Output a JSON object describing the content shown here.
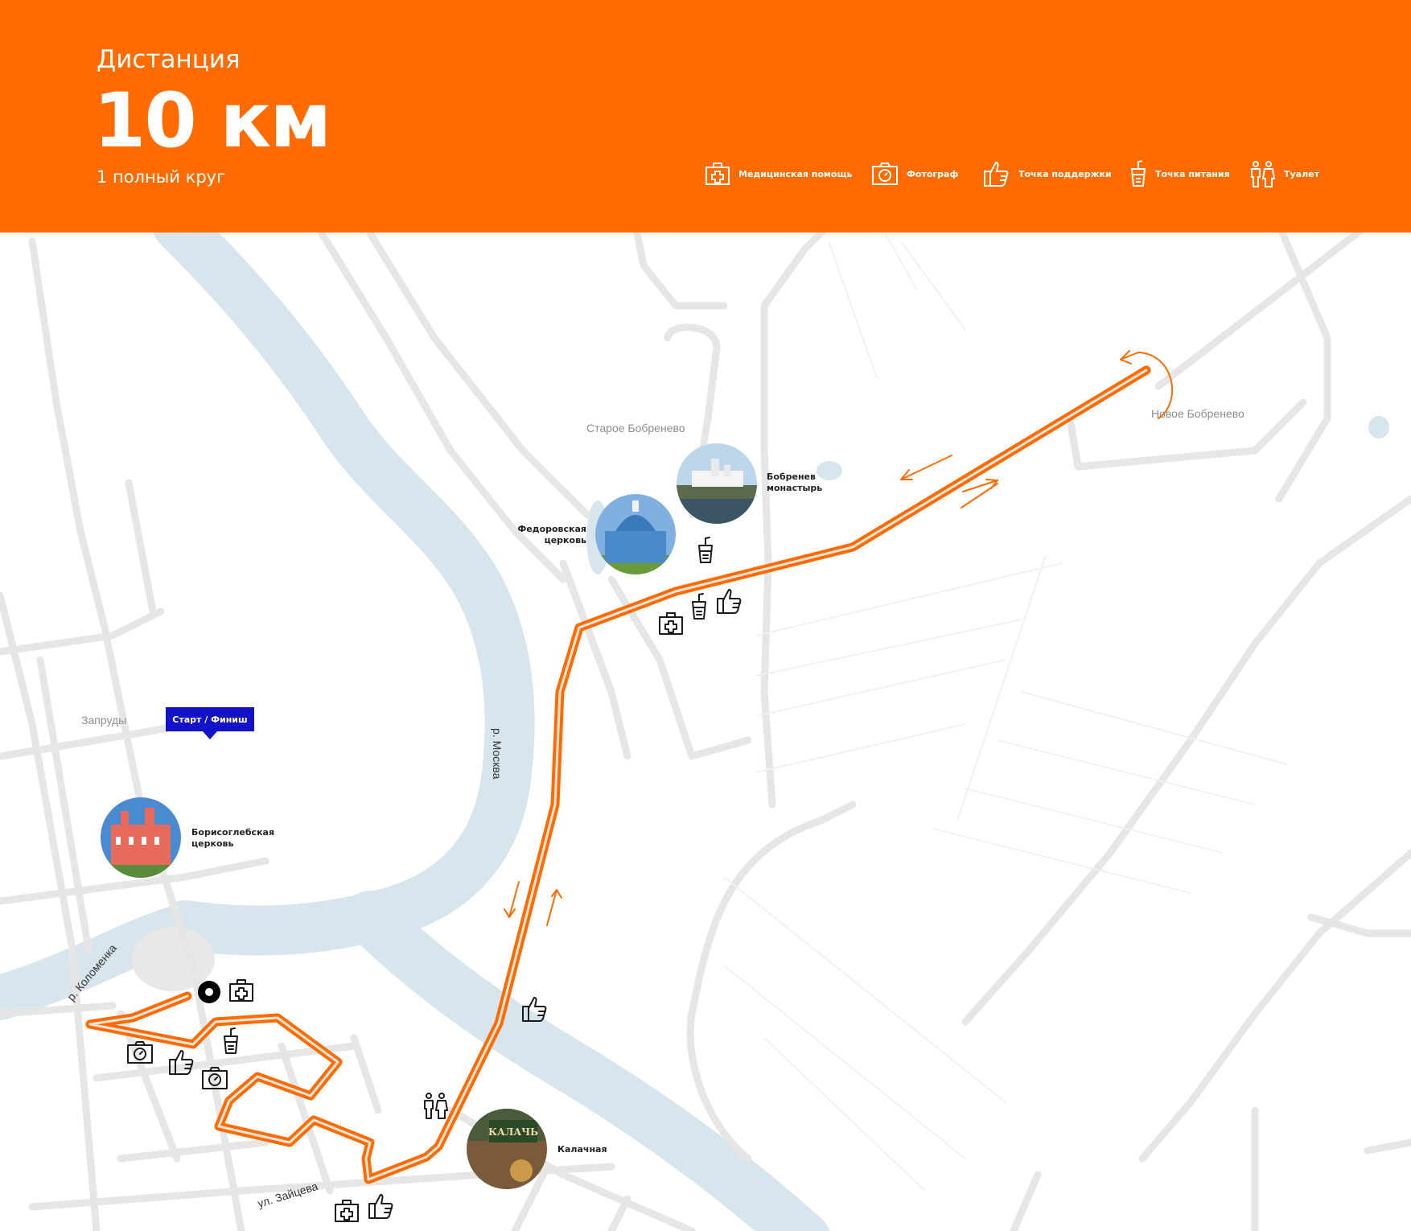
{
  "header": {
    "subtitle": "Дистанция",
    "distance": "10 км",
    "laps": "1 полный круг"
  },
  "legend": {
    "medical": "Медицинская помощь",
    "photo": "Фотограф",
    "support": "Точка поддержки",
    "food": "Точка питания",
    "toilet": "Туалет"
  },
  "places": {
    "old_bobrenevo": "Старое Бобренево",
    "new_bobrenevo": "Новое Бобренево",
    "zaprudy": "Запруды",
    "river_moskva": "р. Москва",
    "river_kolomenka": "р. Коломенка",
    "street_zaytseva": "ул. Зайцева"
  },
  "pois": {
    "monastery": "Бобренев\nмонастырь",
    "fedorovskaya": "Федоровская\nцерковь",
    "borisoglebskaya": "Борисоглебская\nцерковь",
    "kalachnaya": "Калачная",
    "kalachnaya_sign": "КАЛАЧЬ"
  },
  "start_finish": "Старт / Финиш",
  "colors": {
    "header": "#ff6b00",
    "route": "#ff6b00",
    "water": "#d7e5ec",
    "road": "#e6e6e6",
    "start_badge": "#1212c8"
  },
  "icons": [
    "medical-kit-icon",
    "camera-icon",
    "thumbs-up-icon",
    "cup-icon",
    "toilet-icon"
  ]
}
